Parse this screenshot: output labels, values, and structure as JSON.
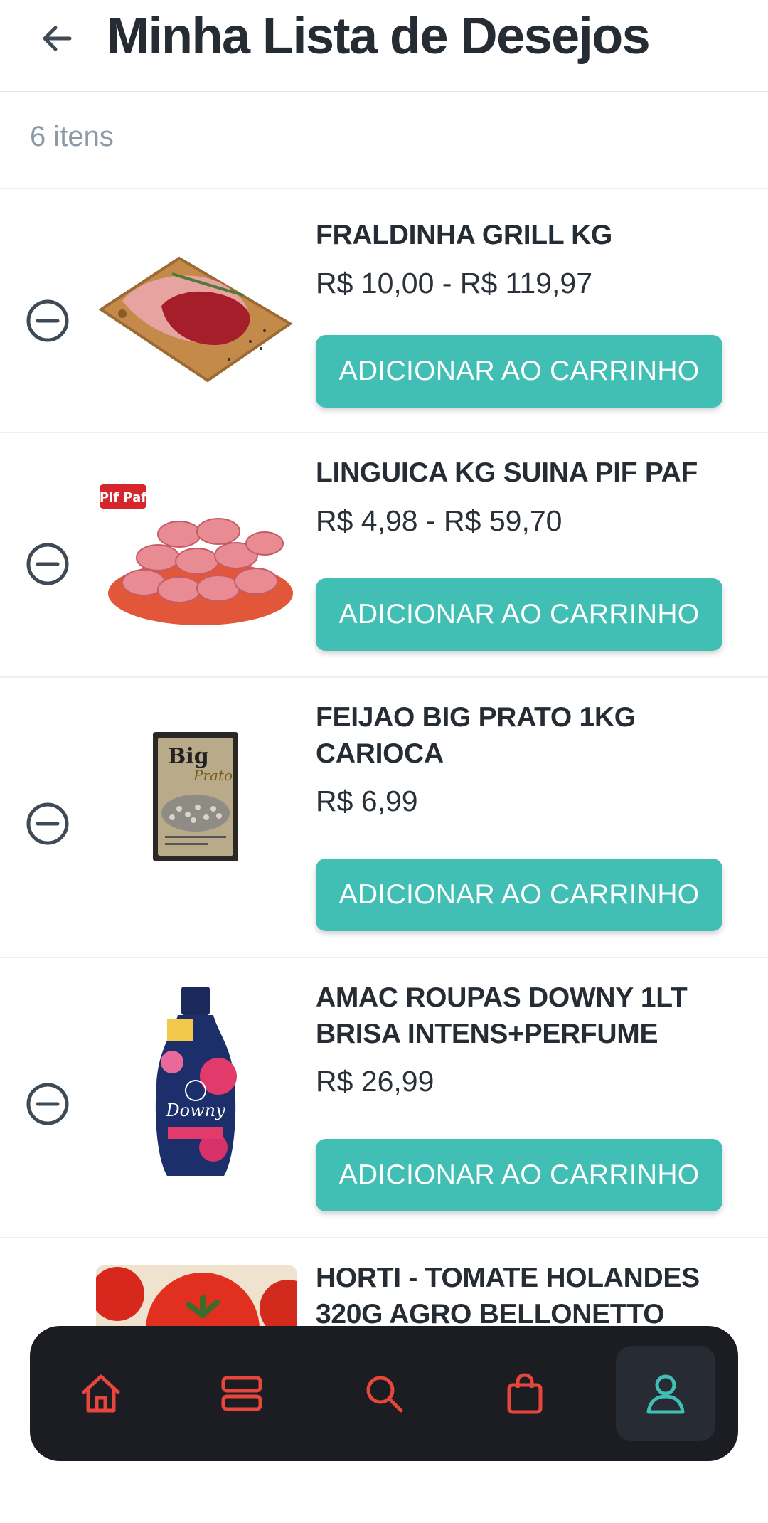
{
  "header": {
    "title": "Minha Lista de Desejos"
  },
  "list_meta": {
    "count": "6 itens"
  },
  "items": [
    {
      "name": "FRALDINHA GRILL KG",
      "price": "R$ 10,00 - R$ 119,97",
      "button": "ADICIONAR AO CARRINHO",
      "image": "beef-cut-on-board"
    },
    {
      "name": "LINGUICA KG SUINA PIF PAF",
      "price": "R$ 4,98 - R$ 59,70",
      "button": "ADICIONAR AO CARRINHO",
      "image": "pork-sausages-on-plate",
      "brand": "Pif Paf"
    },
    {
      "name": "FEIJAO BIG PRATO 1KG CARIOCA",
      "price": "R$ 6,99",
      "button": "ADICIONAR AO CARRINHO",
      "image": "bean-package",
      "brand": "Big Prato"
    },
    {
      "name": "AMAC ROUPAS DOWNY 1LT BRISA INTENS+PERFUME",
      "price": "R$ 26,99",
      "button": "ADICIONAR AO CARRINHO",
      "image": "fabric-softener-bottle",
      "brand": "Downy"
    },
    {
      "name": "HORTI - TOMATE HOLANDES 320G AGRO BELLONETTO",
      "image": "tomatoes"
    }
  ],
  "nav": {
    "items": [
      {
        "icon": "home-icon"
      },
      {
        "icon": "categories-icon"
      },
      {
        "icon": "search-icon"
      },
      {
        "icon": "shopping-bag-icon"
      },
      {
        "icon": "profile-icon",
        "active": true
      }
    ]
  },
  "colors": {
    "accent": "#41bfb5",
    "nav_background": "#1b1d22",
    "nav_icon": "#e8453c",
    "nav_icon_active": "#41bfb5",
    "remove_icon": "#3f4a55"
  }
}
